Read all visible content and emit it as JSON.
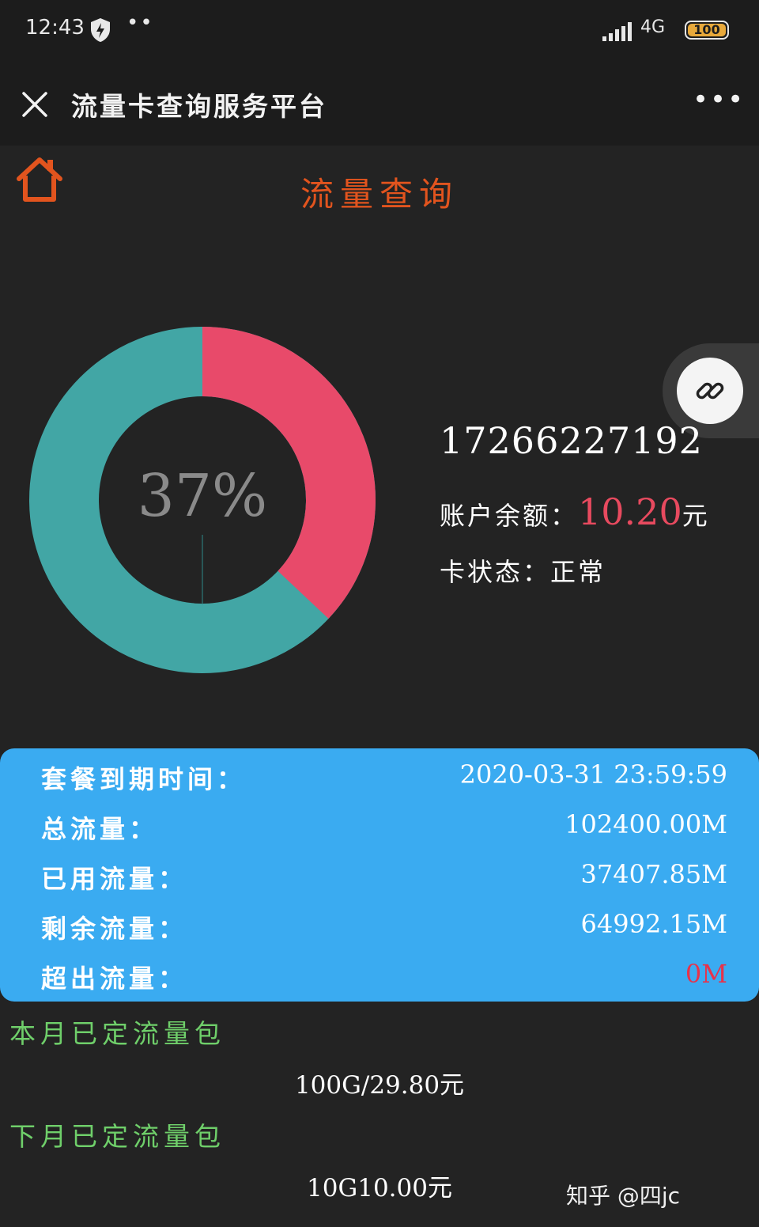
{
  "status_bar": {
    "time": "12:43",
    "dots": "••",
    "network": "4G",
    "battery": "100"
  },
  "title_bar": {
    "title": "流量卡查询服务平台",
    "more": "•••"
  },
  "page": {
    "title": "流量查询"
  },
  "usage_chart": {
    "percent_label": "37%",
    "used_percent": 37,
    "colors": {
      "used": "#e84a6a",
      "remaining": "#42a6a5"
    }
  },
  "account": {
    "phone": "17266227192",
    "balance_label": "账户余额：",
    "balance_value": "10.20",
    "balance_unit": "元",
    "status_label": "卡状态：",
    "status_value": "正常"
  },
  "plan_info": [
    {
      "label": "套餐到期时间：",
      "value": "2020-03-31 23:59:59",
      "highlight": false
    },
    {
      "label": "总流量：",
      "value": "102400.00M",
      "highlight": false
    },
    {
      "label": "已用流量：",
      "value": "37407.85M",
      "highlight": false
    },
    {
      "label": "剩余流量：",
      "value": "64992.15M",
      "highlight": false
    },
    {
      "label": "超出流量：",
      "value": "0M",
      "highlight": true
    }
  ],
  "packages": {
    "this_month_label": "本月已定流量包",
    "this_month_value": "100G/29.80元",
    "next_month_label": "下月已定流量包",
    "next_month_value": "10G10.00元"
  },
  "watermark": "知乎 @四jc",
  "colors": {
    "accent_orange": "#e2541e",
    "card_blue": "#3aabf1",
    "package_green": "#6fcf6a",
    "alert_red": "#e84a5f"
  }
}
